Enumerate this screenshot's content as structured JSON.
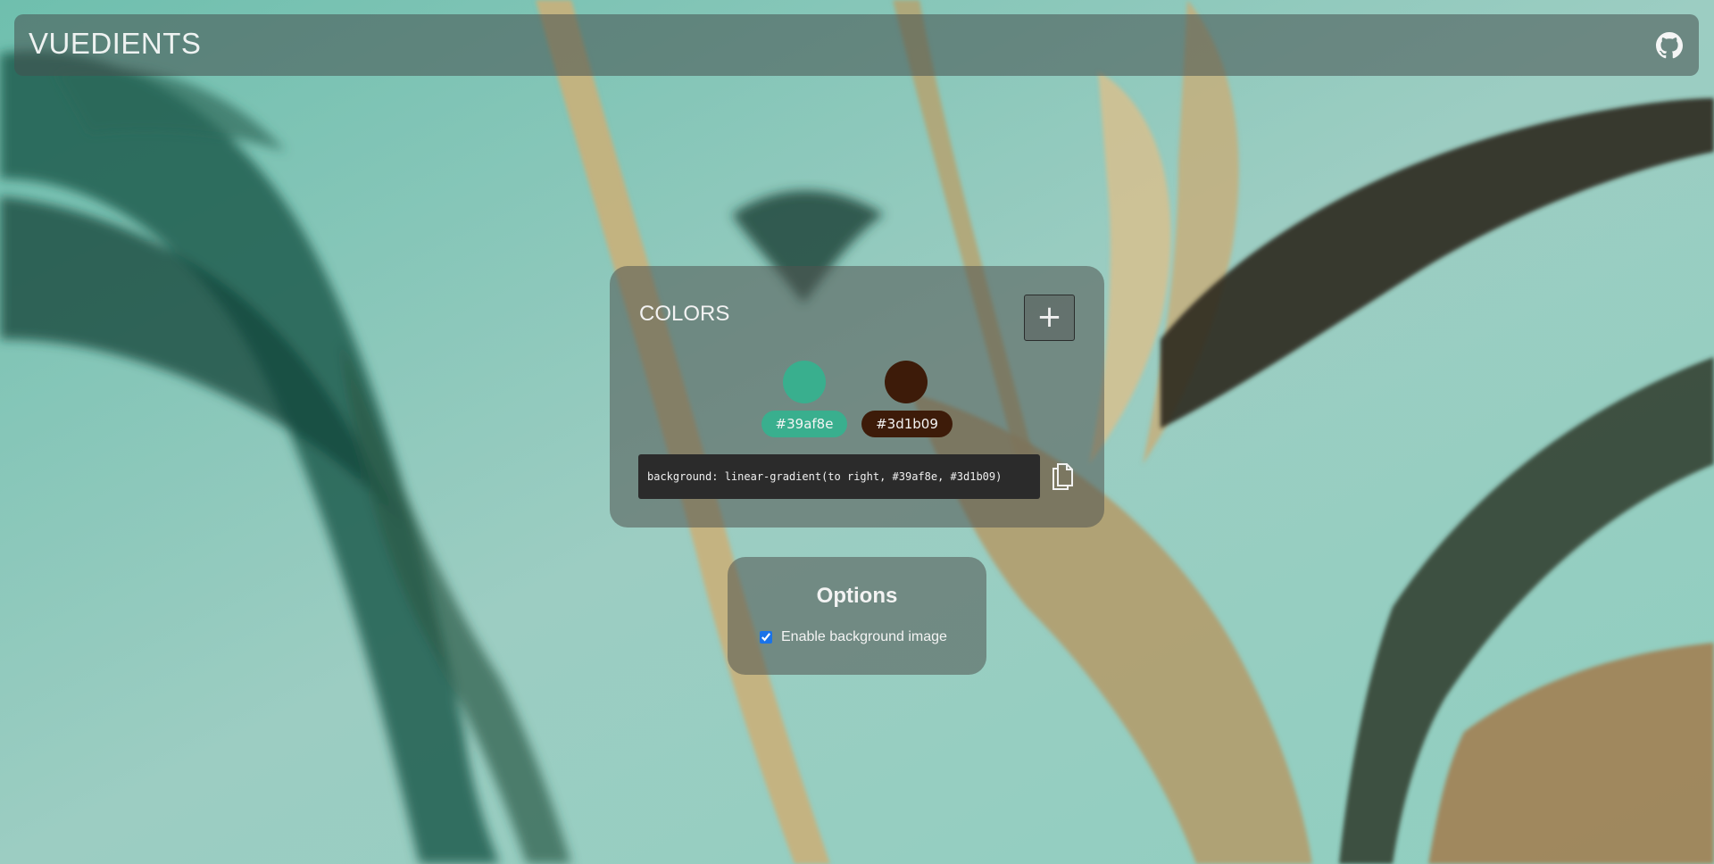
{
  "app": {
    "brand": "VUEDIENTS",
    "github_icon": "github-icon"
  },
  "colors_card": {
    "title": "COLORS",
    "add_label": "+",
    "colors": [
      {
        "hex": "#39af8e",
        "label": "#39af8e"
      },
      {
        "hex": "#3d1b09",
        "label": "#3d1b09"
      }
    ],
    "css_output": "background: linear-gradient(to right, #39af8e, #3d1b09)",
    "copy_icon": "copy-icon"
  },
  "options_card": {
    "title": "Options",
    "enable_bg_label": "Enable background image",
    "enable_bg_checked": true
  },
  "theme": {
    "accent_green": "#39af8e",
    "accent_brown": "#3d1b09",
    "checkbox_blue": "#1a73e8"
  }
}
